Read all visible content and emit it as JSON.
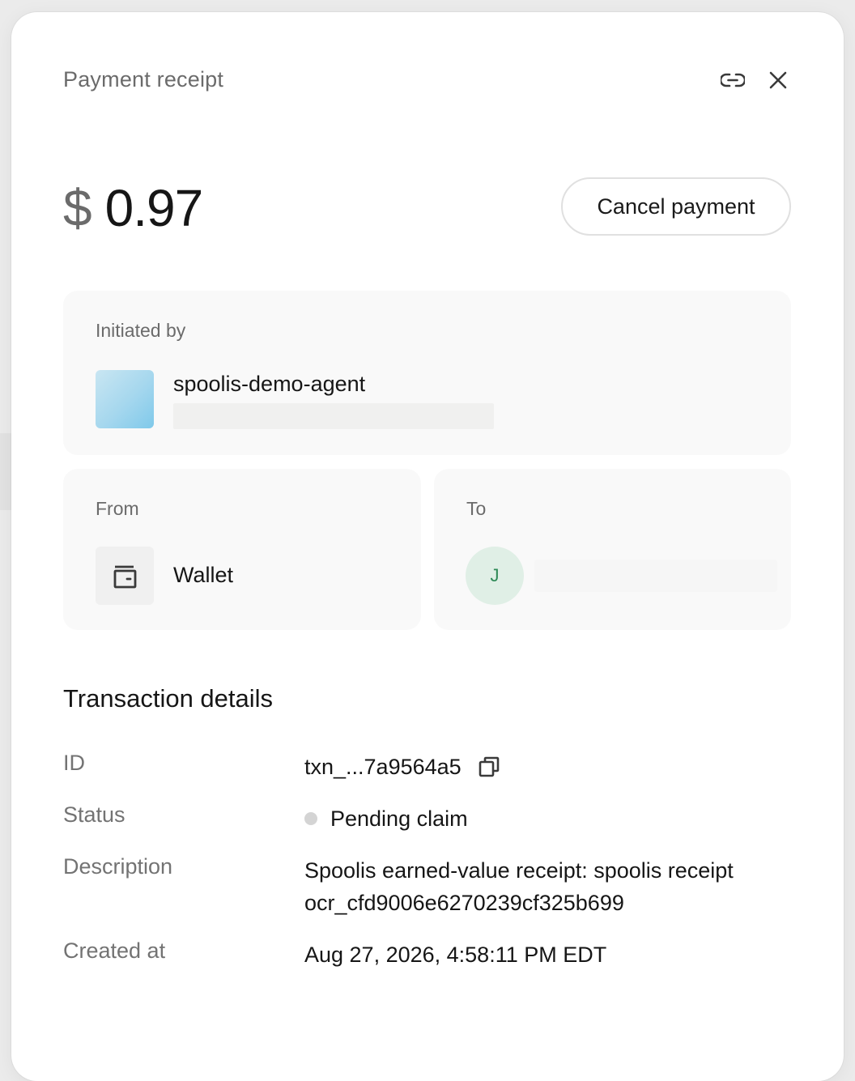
{
  "header": {
    "title": "Payment receipt",
    "link_icon": "link-icon",
    "close_icon": "close-icon"
  },
  "amount": {
    "currency": "$",
    "value": "0.97"
  },
  "actions": {
    "cancel_label": "Cancel payment"
  },
  "initiated_by": {
    "label": "Initiated by",
    "name": "spoolis-demo-agent"
  },
  "from": {
    "label": "From",
    "account": "Wallet",
    "icon": "wallet-icon"
  },
  "to": {
    "label": "To",
    "avatar_initial": "J"
  },
  "transaction": {
    "title": "Transaction details",
    "id_label": "ID",
    "id_value": "txn_...7a9564a5",
    "status_label": "Status",
    "status_value": "Pending claim",
    "description_label": "Description",
    "description_value": "Spoolis earned-value receipt: spoolis receipt ocr_cfd9006e6270239cf325b699",
    "created_label": "Created at",
    "created_value": "Aug 27, 2026, 4:58:11 PM EDT"
  },
  "colors": {
    "status_pending": "#d4d4d4",
    "to_avatar_bg": "#e0efe6",
    "to_avatar_text": "#2e8a57"
  }
}
